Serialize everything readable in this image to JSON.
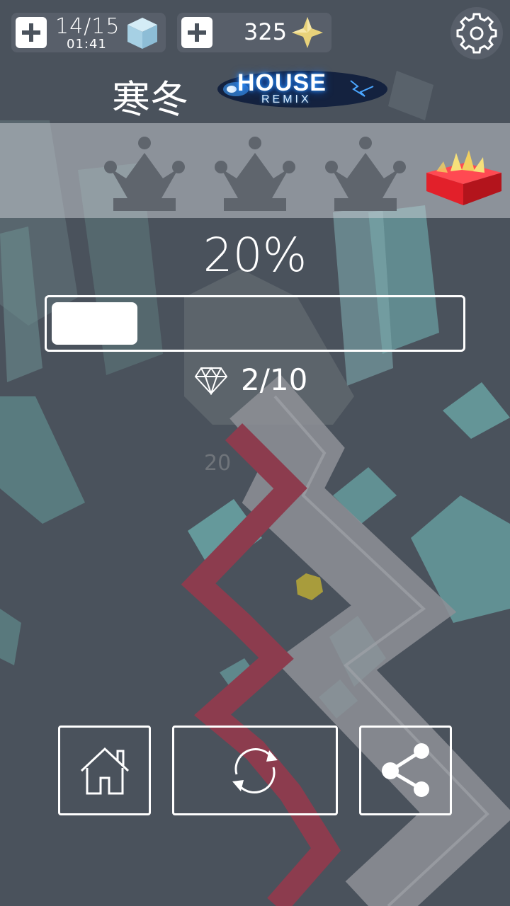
{
  "hud": {
    "lives": "14/15",
    "lives_timer": "01:41",
    "gems": "325"
  },
  "level": {
    "title": "寒冬",
    "genre_logo_main": "HOUSE",
    "genre_logo_sub": "REMIX",
    "crowns_earned": 0,
    "crowns_total": 3
  },
  "progress": {
    "percent_label": "20%",
    "fraction": 0.2,
    "diamonds": "2/10"
  },
  "track": {
    "floating_text": "20"
  },
  "colors": {
    "background": "#4a525c",
    "crown": "#5f656d",
    "gift": "#e2202a",
    "path_red": "#8c3c4e",
    "path_grey": "#8e9096",
    "block_teal": "#6aa6a6"
  },
  "icons": {
    "lives": "cube-icon",
    "gems": "star-icon",
    "settings": "gear-icon",
    "home": "home-icon",
    "restart": "restart-icon",
    "share": "share-icon",
    "diamond": "diamond-icon",
    "reward": "gift-box-icon"
  }
}
